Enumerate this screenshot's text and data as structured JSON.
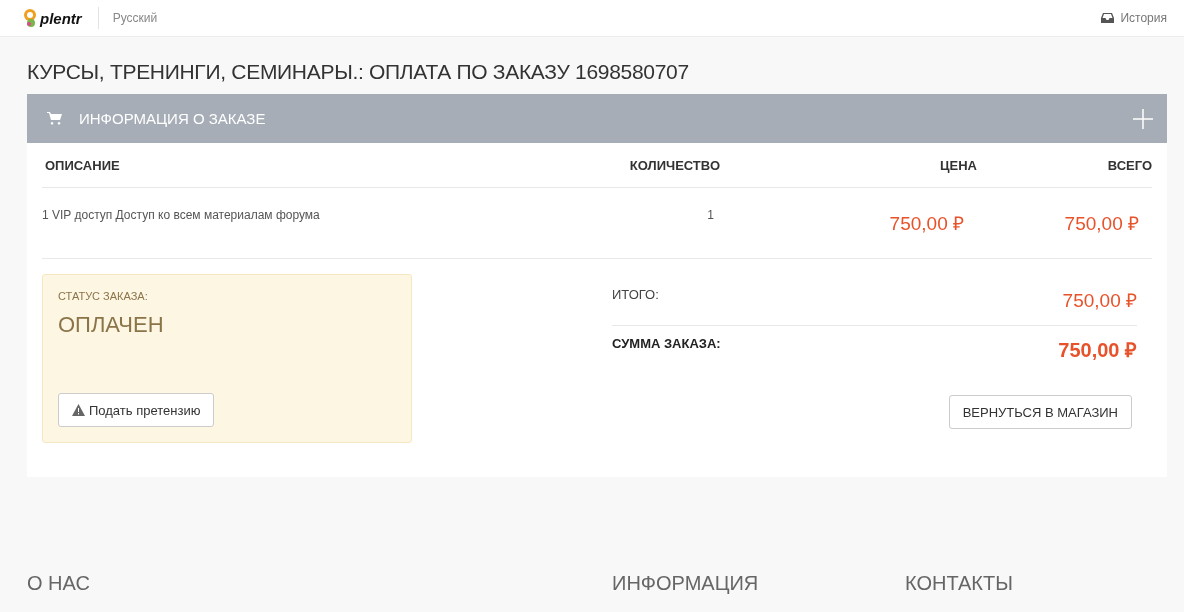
{
  "header": {
    "logo": "plentr",
    "language": "Русский",
    "history_link": "История"
  },
  "page_title": "КУРСЫ, ТРЕНИНГИ, СЕМИНАРЫ.: ОПЛАТА ПО ЗАКАЗУ 1698580707",
  "panel": {
    "title": "ИНФОРМАЦИЯ О ЗАКАЗЕ",
    "expanded": false
  },
  "table": {
    "columns": [
      "ОПИСАНИЕ",
      "КОЛИЧЕСТВО",
      "ЦЕНА",
      "ВСЕГО"
    ],
    "rows": [
      {
        "description": "1 VIP доступ Доступ ко всем материалам форума",
        "quantity": "1",
        "price": "750,00 ₽",
        "total": "750,00 ₽"
      }
    ]
  },
  "status": {
    "label": "СТАТУС ЗАКАЗА:",
    "value": "ОПЛАЧЕН",
    "button": "Подать претензию"
  },
  "summary": [
    {
      "kind": "subtotal",
      "label": "ИТОГО:",
      "value": "750,00 ₽"
    },
    {
      "kind": "grand",
      "label": "СУММА ЗАКАЗА:",
      "value": "750,00 ₽"
    }
  ],
  "return_button": "ВЕРНУТЬСЯ В МАГАЗИН",
  "footer": {
    "headings": [
      "О НАС",
      "ИНФОРМАЦИЯ",
      "КОНТАКТЫ"
    ]
  }
}
